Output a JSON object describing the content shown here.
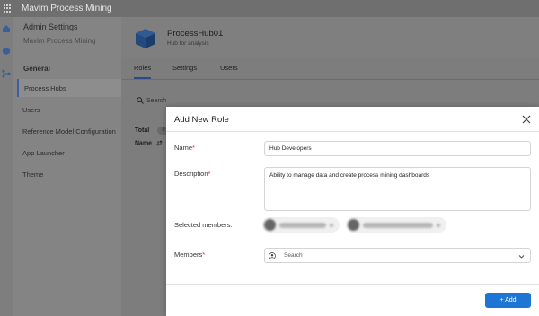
{
  "app": {
    "title": "Mavim Process Mining"
  },
  "leftnav": {
    "header": "Admin Settings",
    "subheader": "Mavim Process Mining",
    "section": "General",
    "items": [
      {
        "label": "Process Hubs",
        "active": true
      },
      {
        "label": "Users"
      },
      {
        "label": "Reference Model Configuration"
      },
      {
        "label": "App Launcher"
      },
      {
        "label": "Theme"
      }
    ]
  },
  "hub": {
    "name": "ProcessHub01",
    "subtitle": "Hub for analysis"
  },
  "tabs": [
    {
      "label": "Roles",
      "active": true
    },
    {
      "label": "Settings"
    },
    {
      "label": "Users"
    }
  ],
  "search": {
    "placeholder": "Search"
  },
  "table": {
    "total_label": "Total",
    "total_count": "0",
    "name_header": "Name"
  },
  "modal": {
    "title": "Add New Role",
    "name_label": "Name",
    "name_value": "Hub Developers",
    "description_label": "Description",
    "description_value": "Ability to manage data and create process mining dashboards",
    "selected_members_label": "Selected members:",
    "members_label": "Members",
    "members_placeholder": "Search",
    "required_marker": "*",
    "add_button": "+ Add"
  },
  "colors": {
    "accent": "#1e76d4",
    "required": "#d13438",
    "overlay": "#7a7a7a"
  }
}
